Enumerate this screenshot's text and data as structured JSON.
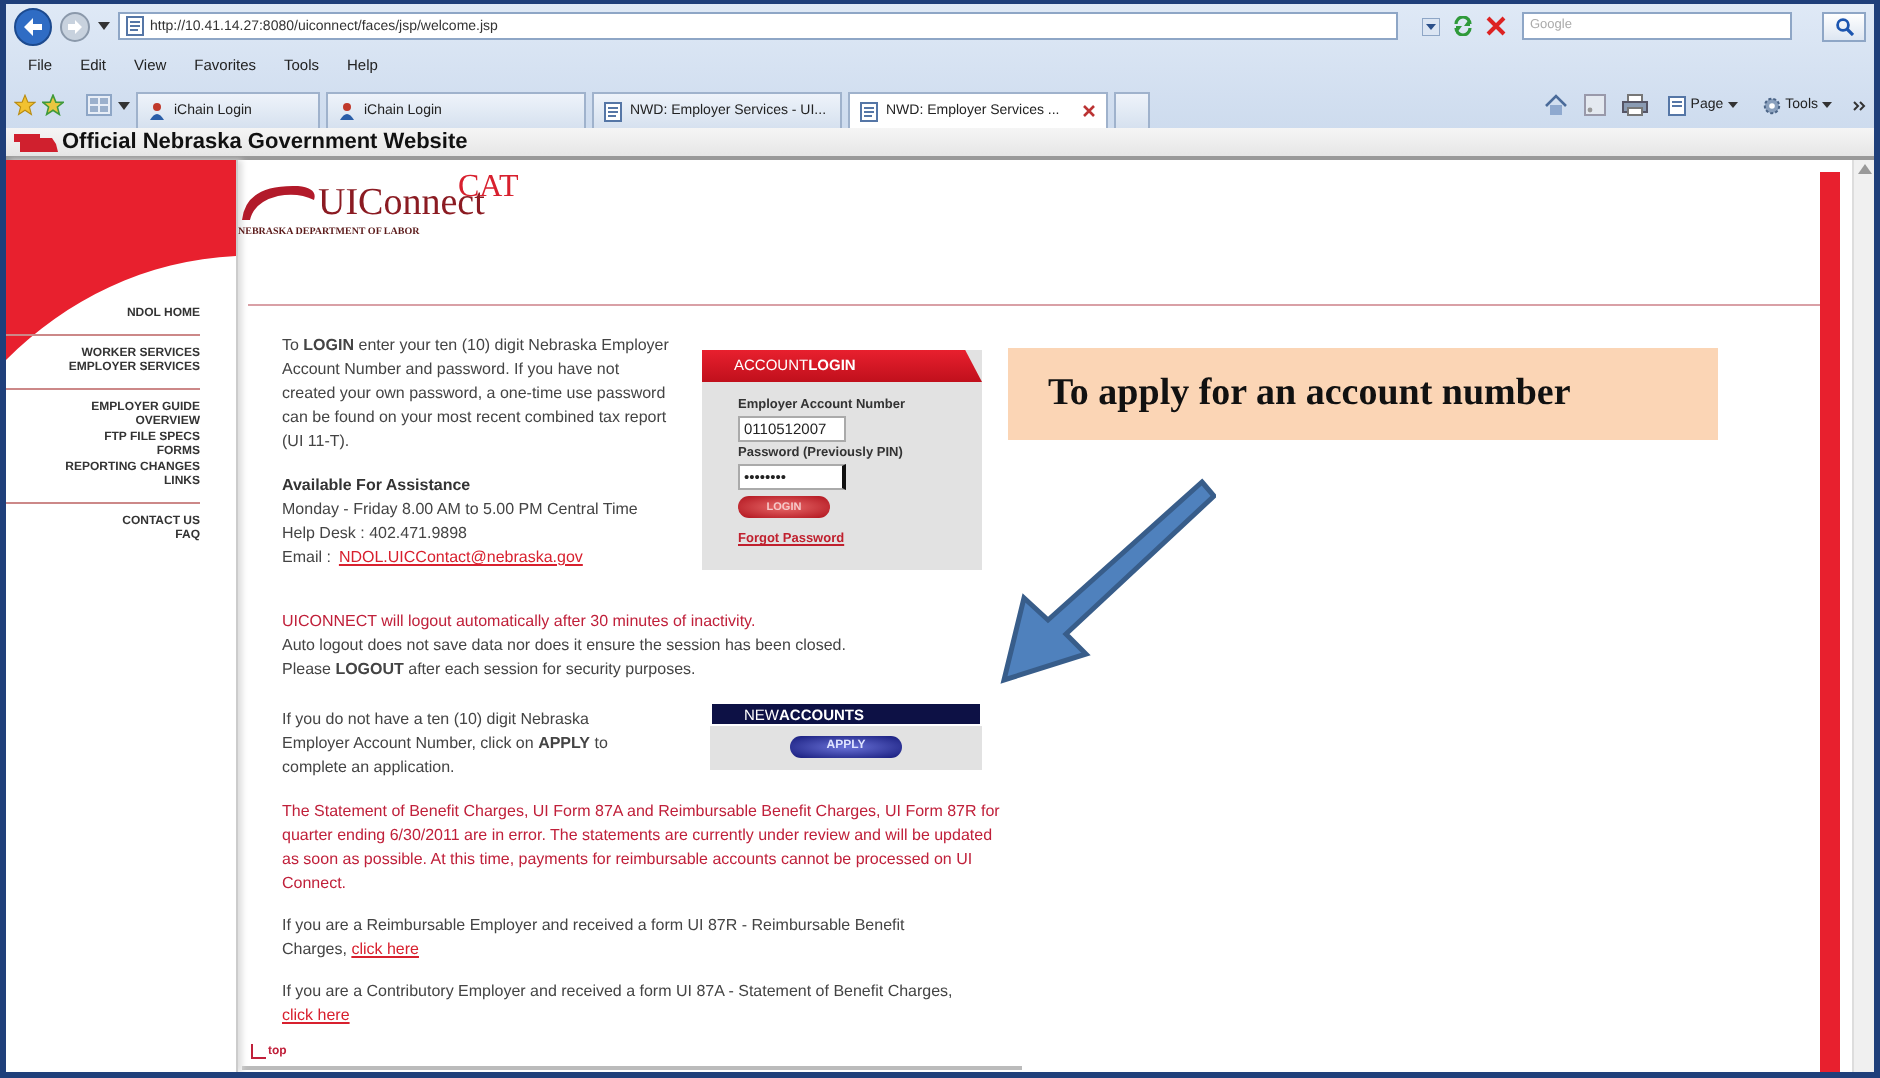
{
  "browser": {
    "address": "http://10.41.14.27:8080/uiconnect/faces/jsp/welcome.jsp",
    "search": {
      "placeholder": "Google"
    },
    "menu": [
      "File",
      "Edit",
      "View",
      "Favorites",
      "Tools",
      "Help"
    ],
    "tabs": [
      {
        "label": "iChain Login",
        "selected": false,
        "kind": "person"
      },
      {
        "label": "iChain Login",
        "selected": false,
        "kind": "person"
      },
      {
        "label": "NWD: Employer Services - UI...",
        "selected": false,
        "kind": "page"
      },
      {
        "label": "NWD: Employer Services ...",
        "selected": true,
        "kind": "page"
      }
    ],
    "toolbar": [
      "Page",
      "Tools"
    ]
  },
  "site": {
    "banner": "Official Nebraska Government Website",
    "logo": {
      "name": "UIConnect",
      "overlay": "CAT",
      "subtitle": "NEBRASKA DEPARTMENT OF LABOR"
    },
    "nav": [
      [
        "NDOL HOME"
      ],
      [
        "WORKER SERVICES",
        "EMPLOYER SERVICES"
      ],
      [
        "EMPLOYER GUIDE",
        "OVERVIEW",
        "FTP FILE SPECS",
        "FORMS",
        "REPORTING CHANGES",
        "LINKS"
      ],
      [
        "CONTACT US",
        "FAQ"
      ]
    ]
  },
  "intro": "To **LOGIN** enter your ten (10) digit Nebraska Employer Account Number and password. If you have not created your own password, a one-time use password can be found on your most recent combined tax report (UI 11-T).",
  "assistance": {
    "heading": "Available For Assistance",
    "lines": [
      "Monday - Friday 8.00 AM to 5.00 PM Central Time",
      "Help Desk : 402.471.9898"
    ],
    "email_label": "Email :",
    "email": "NDOL.UICContact@nebraska.gov"
  },
  "login": {
    "title": "ACCOUNT**LOGIN**",
    "fields": [
      {
        "label": "Employer Account Number",
        "value": "0110512007"
      },
      {
        "label": "Password (Previously PIN)",
        "value": "••••••••"
      }
    ],
    "button": "LOGIN",
    "link": "Forgot Password"
  },
  "logout_notice": {
    "warning": "UICONNECT will logout automatically after 30 minutes of inactivity.",
    "lines": [
      "Auto logout does not save data nor does it ensure the session has been closed.",
      "Please **LOGOUT** after each session for security purposes."
    ]
  },
  "new_accounts": {
    "text": "If you do not have a ten (10) digit Nebraska Employer Account Number, click on **APPLY** to complete an application.",
    "title": "NEW**ACCOUNTS**",
    "button": "APPLY"
  },
  "statement_notice": "The Statement of Benefit Charges, UI Form 87A and Reimbursable Benefit Charges, UI Form 87R for quarter ending 6/30/2011 are in error. The statements are currently under review and will be updated as soon as possible. At this time, payments for reimbursable accounts cannot be processed on UI Connect.",
  "form_links": [
    {
      "text": "If you are a Reimbursable Employer and received a form UI 87R - Reimbursable Benefit Charges,",
      "link": "click here"
    },
    {
      "text": "If you are a Contributory Employer and received a form UI 87A - Statement of Benefit Charges,",
      "link": "click here"
    }
  ],
  "top_link": "top",
  "callout": "To apply for an account number"
}
